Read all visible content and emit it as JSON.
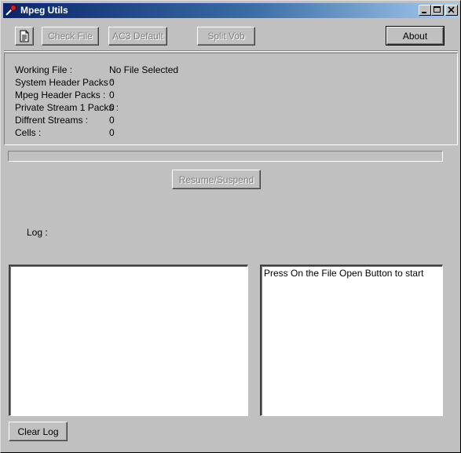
{
  "window": {
    "title": "Mpeg Utils"
  },
  "toolbar": {
    "check_file_label": "Check File",
    "ac3_default_label": "AC3 Default",
    "split_vob_label": "Split Vob",
    "about_label": "About"
  },
  "info": {
    "rows": [
      {
        "label": "Working File :",
        "value": "No File Selected"
      },
      {
        "label": "System Header Packs :",
        "value": "0"
      },
      {
        "label": "Mpeg Header Packs :",
        "value": "0"
      },
      {
        "label": "Private Stream 1 Packs :",
        "value": "0"
      },
      {
        "label": "Diffrent Streams :",
        "value": "0"
      },
      {
        "label": "Cells :",
        "value": "0"
      }
    ]
  },
  "progress": {
    "value": 0
  },
  "controls": {
    "resume_suspend_label": "Resume/Suspend",
    "log_label": "Log :",
    "clear_log_label": "Clear Log"
  },
  "log": {
    "left_text": "",
    "right_text": "Press On the File Open Button to start"
  },
  "colors": {
    "title_bar_start": "#0a246a",
    "title_bar_end": "#a6caf0",
    "face": "#c0c0c0"
  }
}
